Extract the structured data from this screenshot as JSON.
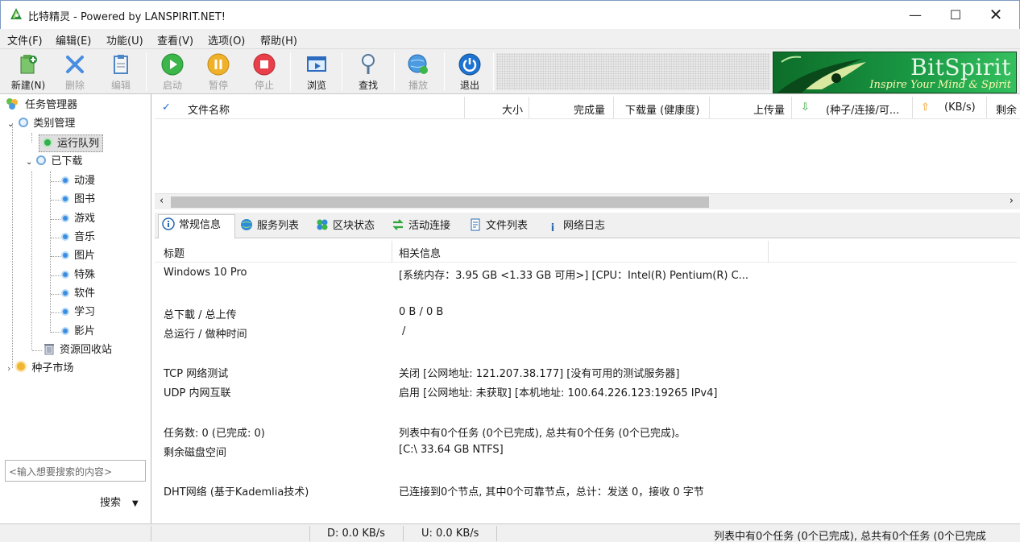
{
  "window": {
    "title": "比特精灵 - Powered by LANSPIRIT.NET!"
  },
  "menu": [
    "文件(F)",
    "编辑(E)",
    "功能(U)",
    "查看(V)",
    "选项(O)",
    "帮助(H)"
  ],
  "toolbar": {
    "new": "新建(N)",
    "delete": "删除",
    "edit": "编辑",
    "start": "启动",
    "pause": "暂停",
    "stop": "停止",
    "browse": "浏览",
    "find": "查找",
    "play": "播放",
    "exit": "退出"
  },
  "logo": {
    "name": "BitSpirit",
    "slogan": "Inspire Your Mind & Spirit"
  },
  "tree": {
    "root": "任务管理器",
    "category": "类别管理",
    "running": "运行队列",
    "downloaded": "已下载",
    "children": [
      "动漫",
      "图书",
      "游戏",
      "音乐",
      "图片",
      "特殊",
      "软件",
      "学习",
      "影片"
    ],
    "recycle": "资源回收站",
    "seed_market": "种子市场"
  },
  "search": {
    "placeholder": "<输入想要搜索的内容>",
    "button": "搜索"
  },
  "list": {
    "columns": {
      "name": "文件名称",
      "size": "大小",
      "done": "完成量",
      "downloaded": "下载量 (健康度)",
      "uploaded": "上传量",
      "seeds": "(种子/连接/可...",
      "rate": "(KB/s)",
      "remain": "剩余"
    }
  },
  "tabs": [
    "常规信息",
    "服务列表",
    "区块状态",
    "活动连接",
    "文件列表",
    "网络日志"
  ],
  "info": {
    "header": {
      "title": "标题",
      "detail": "相关信息"
    },
    "rows": [
      {
        "k": "Windows 10 Pro",
        "v": "[系统内存：3.95 GB <1.33 GB 可用>] [CPU：Intel(R) Pentium(R) C..."
      },
      {
        "k": "总下載 / 总上传",
        "v": "0 B / 0 B"
      },
      {
        "k": "总运行 / 做种时间",
        "v": "/"
      },
      {
        "k": "TCP 网络测试",
        "v": "关闭 [公网地址: 121.207.38.177] [没有可用的测试服务器]"
      },
      {
        "k": "UDP 内网互联",
        "v": "启用 [公网地址: 未获取] [本机地址: 100.64.226.123:19265 IPv4]"
      },
      {
        "k": "任务数: 0 (已完成: 0)",
        "v": "列表中有0个任务 (0个已完成), 总共有0个任务 (0个已完成)。"
      },
      {
        "k": "剩余磁盘空间",
        "v": "[C:\\ 33.64 GB  NTFS]"
      },
      {
        "k": "DHT网络 (基于Kademlia技术)",
        "v": "已连接到0个节点, 其中0个可靠节点，总计：发送 0，接收 0 字节"
      }
    ]
  },
  "status": {
    "download": "D: 0.0 KB/s",
    "upload": "U: 0.0 KB/s",
    "summary": "列表中有0个任务 (0个已完成), 总共有0个任务 (0个已完成"
  },
  "colors": {
    "logo_green": "#1a9a45",
    "node_blue": "#3a8ee0",
    "node_green": "#2fb34a"
  }
}
